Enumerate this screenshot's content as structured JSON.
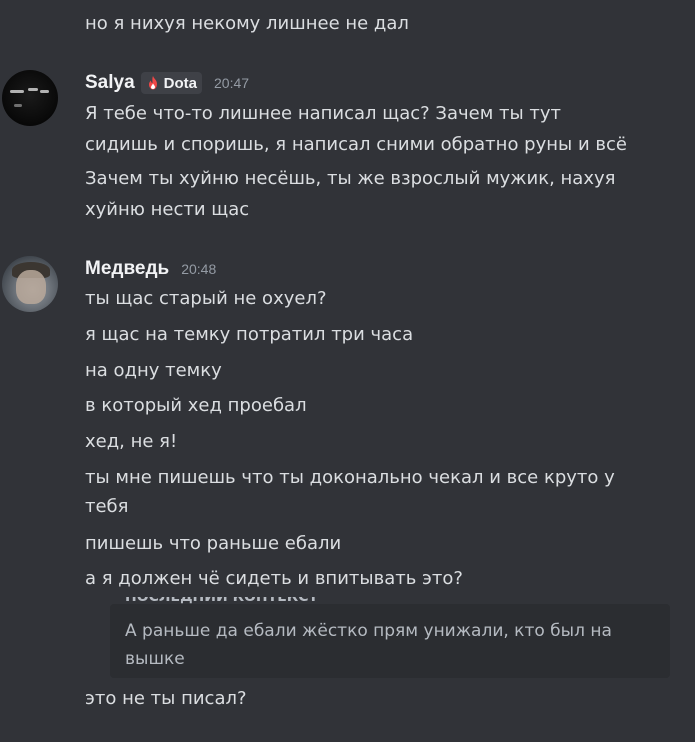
{
  "prev_message": {
    "text": "но я нихуя некому лишнее не дал"
  },
  "messages": [
    {
      "author": "Salya",
      "tag": "Dota",
      "tag_icon": "flame-icon",
      "time": "20:47",
      "lines": [
        "Я тебе что-то лишнее написал щас? Зачем ты тут",
        "сидишь и споришь, я написал сними обратно руны и всё",
        "Зачем ты хуйню несёшь, ты же взрослый мужик, нахуя",
        "хуйню нести щас"
      ]
    },
    {
      "author": "Медведь",
      "time": "20:48",
      "lines": [
        "ты щас старый не охуел?",
        "я щас на темку потратил три часа",
        "на одну темку",
        "в который хед проебал",
        "хед, не я!",
        "ты мне пишешь что ты доконально чекал и все круто у",
        "тебя",
        "пишешь что раньше ебали",
        "а я должен чё сидеть и впитывать это?"
      ],
      "quote": {
        "partial_header": "ПОСЛЕДНИЙ КОНТЕКСТ",
        "text": "А раньше да ебали жёстко прям унижали, кто был на вышке"
      },
      "after_quote": "это не ты писал?"
    }
  ],
  "colors": {
    "background": "#313338",
    "text": "#dbdee1",
    "username": "#f2f3f5",
    "timestamp": "#949ba4",
    "tag_bg": "#3f4147",
    "quote_bg": "#2b2d31",
    "flame": "#f04747"
  }
}
